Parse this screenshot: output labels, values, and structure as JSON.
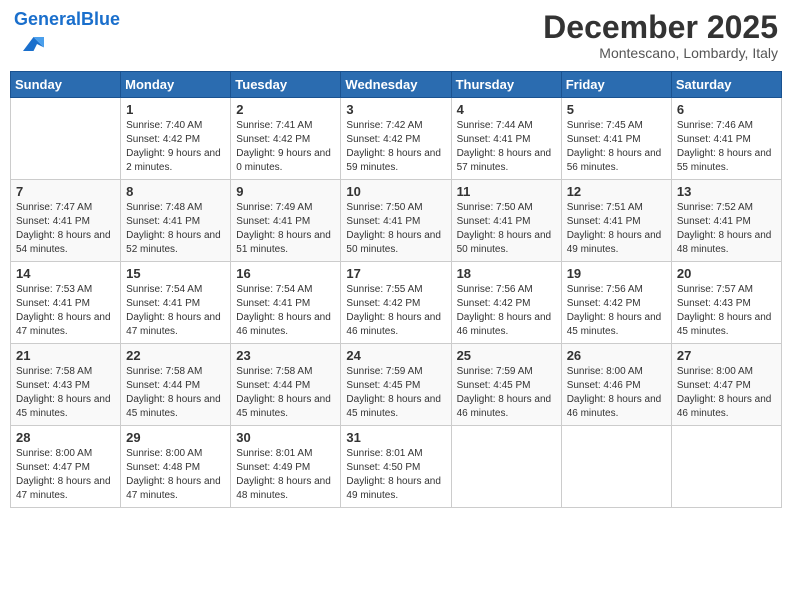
{
  "header": {
    "logo_text_general": "General",
    "logo_text_blue": "Blue",
    "month": "December 2025",
    "location": "Montescano, Lombardy, Italy"
  },
  "days_of_week": [
    "Sunday",
    "Monday",
    "Tuesday",
    "Wednesday",
    "Thursday",
    "Friday",
    "Saturday"
  ],
  "weeks": [
    [
      {
        "day": "",
        "sunrise": "",
        "sunset": "",
        "daylight": ""
      },
      {
        "day": "1",
        "sunrise": "Sunrise: 7:40 AM",
        "sunset": "Sunset: 4:42 PM",
        "daylight": "Daylight: 9 hours and 2 minutes."
      },
      {
        "day": "2",
        "sunrise": "Sunrise: 7:41 AM",
        "sunset": "Sunset: 4:42 PM",
        "daylight": "Daylight: 9 hours and 0 minutes."
      },
      {
        "day": "3",
        "sunrise": "Sunrise: 7:42 AM",
        "sunset": "Sunset: 4:42 PM",
        "daylight": "Daylight: 8 hours and 59 minutes."
      },
      {
        "day": "4",
        "sunrise": "Sunrise: 7:44 AM",
        "sunset": "Sunset: 4:41 PM",
        "daylight": "Daylight: 8 hours and 57 minutes."
      },
      {
        "day": "5",
        "sunrise": "Sunrise: 7:45 AM",
        "sunset": "Sunset: 4:41 PM",
        "daylight": "Daylight: 8 hours and 56 minutes."
      },
      {
        "day": "6",
        "sunrise": "Sunrise: 7:46 AM",
        "sunset": "Sunset: 4:41 PM",
        "daylight": "Daylight: 8 hours and 55 minutes."
      }
    ],
    [
      {
        "day": "7",
        "sunrise": "Sunrise: 7:47 AM",
        "sunset": "Sunset: 4:41 PM",
        "daylight": "Daylight: 8 hours and 54 minutes."
      },
      {
        "day": "8",
        "sunrise": "Sunrise: 7:48 AM",
        "sunset": "Sunset: 4:41 PM",
        "daylight": "Daylight: 8 hours and 52 minutes."
      },
      {
        "day": "9",
        "sunrise": "Sunrise: 7:49 AM",
        "sunset": "Sunset: 4:41 PM",
        "daylight": "Daylight: 8 hours and 51 minutes."
      },
      {
        "day": "10",
        "sunrise": "Sunrise: 7:50 AM",
        "sunset": "Sunset: 4:41 PM",
        "daylight": "Daylight: 8 hours and 50 minutes."
      },
      {
        "day": "11",
        "sunrise": "Sunrise: 7:50 AM",
        "sunset": "Sunset: 4:41 PM",
        "daylight": "Daylight: 8 hours and 50 minutes."
      },
      {
        "day": "12",
        "sunrise": "Sunrise: 7:51 AM",
        "sunset": "Sunset: 4:41 PM",
        "daylight": "Daylight: 8 hours and 49 minutes."
      },
      {
        "day": "13",
        "sunrise": "Sunrise: 7:52 AM",
        "sunset": "Sunset: 4:41 PM",
        "daylight": "Daylight: 8 hours and 48 minutes."
      }
    ],
    [
      {
        "day": "14",
        "sunrise": "Sunrise: 7:53 AM",
        "sunset": "Sunset: 4:41 PM",
        "daylight": "Daylight: 8 hours and 47 minutes."
      },
      {
        "day": "15",
        "sunrise": "Sunrise: 7:54 AM",
        "sunset": "Sunset: 4:41 PM",
        "daylight": "Daylight: 8 hours and 47 minutes."
      },
      {
        "day": "16",
        "sunrise": "Sunrise: 7:54 AM",
        "sunset": "Sunset: 4:41 PM",
        "daylight": "Daylight: 8 hours and 46 minutes."
      },
      {
        "day": "17",
        "sunrise": "Sunrise: 7:55 AM",
        "sunset": "Sunset: 4:42 PM",
        "daylight": "Daylight: 8 hours and 46 minutes."
      },
      {
        "day": "18",
        "sunrise": "Sunrise: 7:56 AM",
        "sunset": "Sunset: 4:42 PM",
        "daylight": "Daylight: 8 hours and 46 minutes."
      },
      {
        "day": "19",
        "sunrise": "Sunrise: 7:56 AM",
        "sunset": "Sunset: 4:42 PM",
        "daylight": "Daylight: 8 hours and 45 minutes."
      },
      {
        "day": "20",
        "sunrise": "Sunrise: 7:57 AM",
        "sunset": "Sunset: 4:43 PM",
        "daylight": "Daylight: 8 hours and 45 minutes."
      }
    ],
    [
      {
        "day": "21",
        "sunrise": "Sunrise: 7:58 AM",
        "sunset": "Sunset: 4:43 PM",
        "daylight": "Daylight: 8 hours and 45 minutes."
      },
      {
        "day": "22",
        "sunrise": "Sunrise: 7:58 AM",
        "sunset": "Sunset: 4:44 PM",
        "daylight": "Daylight: 8 hours and 45 minutes."
      },
      {
        "day": "23",
        "sunrise": "Sunrise: 7:58 AM",
        "sunset": "Sunset: 4:44 PM",
        "daylight": "Daylight: 8 hours and 45 minutes."
      },
      {
        "day": "24",
        "sunrise": "Sunrise: 7:59 AM",
        "sunset": "Sunset: 4:45 PM",
        "daylight": "Daylight: 8 hours and 45 minutes."
      },
      {
        "day": "25",
        "sunrise": "Sunrise: 7:59 AM",
        "sunset": "Sunset: 4:45 PM",
        "daylight": "Daylight: 8 hours and 46 minutes."
      },
      {
        "day": "26",
        "sunrise": "Sunrise: 8:00 AM",
        "sunset": "Sunset: 4:46 PM",
        "daylight": "Daylight: 8 hours and 46 minutes."
      },
      {
        "day": "27",
        "sunrise": "Sunrise: 8:00 AM",
        "sunset": "Sunset: 4:47 PM",
        "daylight": "Daylight: 8 hours and 46 minutes."
      }
    ],
    [
      {
        "day": "28",
        "sunrise": "Sunrise: 8:00 AM",
        "sunset": "Sunset: 4:47 PM",
        "daylight": "Daylight: 8 hours and 47 minutes."
      },
      {
        "day": "29",
        "sunrise": "Sunrise: 8:00 AM",
        "sunset": "Sunset: 4:48 PM",
        "daylight": "Daylight: 8 hours and 47 minutes."
      },
      {
        "day": "30",
        "sunrise": "Sunrise: 8:01 AM",
        "sunset": "Sunset: 4:49 PM",
        "daylight": "Daylight: 8 hours and 48 minutes."
      },
      {
        "day": "31",
        "sunrise": "Sunrise: 8:01 AM",
        "sunset": "Sunset: 4:50 PM",
        "daylight": "Daylight: 8 hours and 49 minutes."
      },
      {
        "day": "",
        "sunrise": "",
        "sunset": "",
        "daylight": ""
      },
      {
        "day": "",
        "sunrise": "",
        "sunset": "",
        "daylight": ""
      },
      {
        "day": "",
        "sunrise": "",
        "sunset": "",
        "daylight": ""
      }
    ]
  ]
}
